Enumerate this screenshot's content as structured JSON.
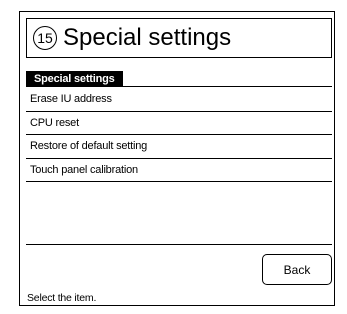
{
  "header": {
    "number": "⑮",
    "title": "Special settings"
  },
  "panel": {
    "tab_label": "Special settings",
    "items": [
      {
        "label": "Erase IU address"
      },
      {
        "label": "CPU reset"
      },
      {
        "label": "Restore of default setting"
      },
      {
        "label": "Touch panel calibration"
      }
    ]
  },
  "footer": {
    "back_label": "Back",
    "status": "Select the item."
  }
}
